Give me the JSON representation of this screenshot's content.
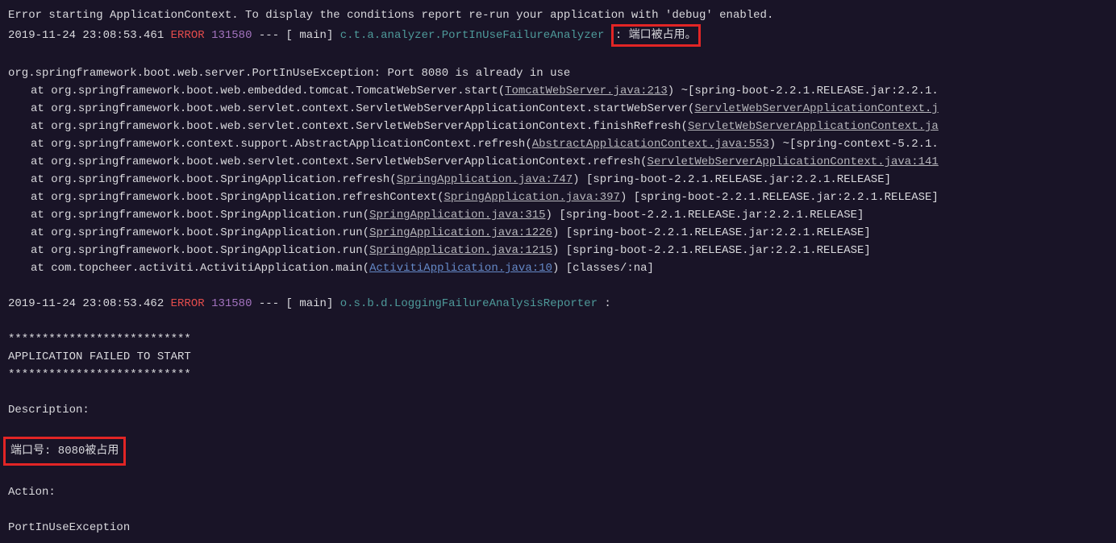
{
  "line_error_start": "Error starting ApplicationContext. To display the conditions report re-run your application with 'debug' enabled.",
  "log_line_1": {
    "timestamp": "2019-11-24 23:08:53.461",
    "level": "ERROR",
    "pid": "131580",
    "dashes": "---",
    "lbr": "[",
    "rbr": "]",
    "thread": "           main",
    "logger": "c.t.a.analyzer.PortInUseFailureAnalyzer",
    "sep_colon": "  :",
    "message": "端口被占用。"
  },
  "exception_header": "org.springframework.boot.web.server.PortInUseException: Port 8080 is already in use",
  "stack_prefix_at": "at ",
  "stack": [
    {
      "pre": "org.springframework.boot.web.embedded.tomcat.TomcatWebServer.start(",
      "file": "TomcatWebServer.java:213",
      "post": ") ~[spring-boot-2.2.1.RELEASE.jar:2.2.1."
    },
    {
      "pre": "org.springframework.boot.web.servlet.context.ServletWebServerApplicationContext.startWebServer(",
      "file": "ServletWebServerApplicationContext.j",
      "post": ""
    },
    {
      "pre": "org.springframework.boot.web.servlet.context.ServletWebServerApplicationContext.finishRefresh(",
      "file": "ServletWebServerApplicationContext.ja",
      "post": ""
    },
    {
      "pre": "org.springframework.context.support.AbstractApplicationContext.refresh(",
      "file": "AbstractApplicationContext.java:553",
      "post": ") ~[spring-context-5.2.1."
    },
    {
      "pre": "org.springframework.boot.web.servlet.context.ServletWebServerApplicationContext.refresh(",
      "file": "ServletWebServerApplicationContext.java:141",
      "post": ""
    },
    {
      "pre": "org.springframework.boot.SpringApplication.refresh(",
      "file": "SpringApplication.java:747",
      "post": ") [spring-boot-2.2.1.RELEASE.jar:2.2.1.RELEASE]"
    },
    {
      "pre": "org.springframework.boot.SpringApplication.refreshContext(",
      "file": "SpringApplication.java:397",
      "post": ") [spring-boot-2.2.1.RELEASE.jar:2.2.1.RELEASE]"
    },
    {
      "pre": "org.springframework.boot.SpringApplication.run(",
      "file": "SpringApplication.java:315",
      "post": ") [spring-boot-2.2.1.RELEASE.jar:2.2.1.RELEASE]"
    },
    {
      "pre": "org.springframework.boot.SpringApplication.run(",
      "file": "SpringApplication.java:1226",
      "post": ") [spring-boot-2.2.1.RELEASE.jar:2.2.1.RELEASE]"
    },
    {
      "pre": "org.springframework.boot.SpringApplication.run(",
      "file": "SpringApplication.java:1215",
      "post": ") [spring-boot-2.2.1.RELEASE.jar:2.2.1.RELEASE]"
    }
  ],
  "stack_final": {
    "pre": "com.topcheer.activiti.ActivitiApplication.main(",
    "file": "ActivitiApplication.java:10",
    "post": ") [classes/:na]"
  },
  "log_line_2": {
    "timestamp": "2019-11-24 23:08:53.462",
    "level": "ERROR",
    "pid": "131580",
    "dashes": "---",
    "lbr": "[",
    "rbr": "]",
    "thread": "           main",
    "logger": "o.s.b.d.LoggingFailureAnalysisReporter",
    "sep_colon": "   :"
  },
  "banner_stars": "***************************",
  "banner_text": "APPLICATION FAILED TO START",
  "description_label": "Description:",
  "port_occupied": "端口号: 8080被占用",
  "action_label": "Action:",
  "port_exception": "PortInUseException"
}
